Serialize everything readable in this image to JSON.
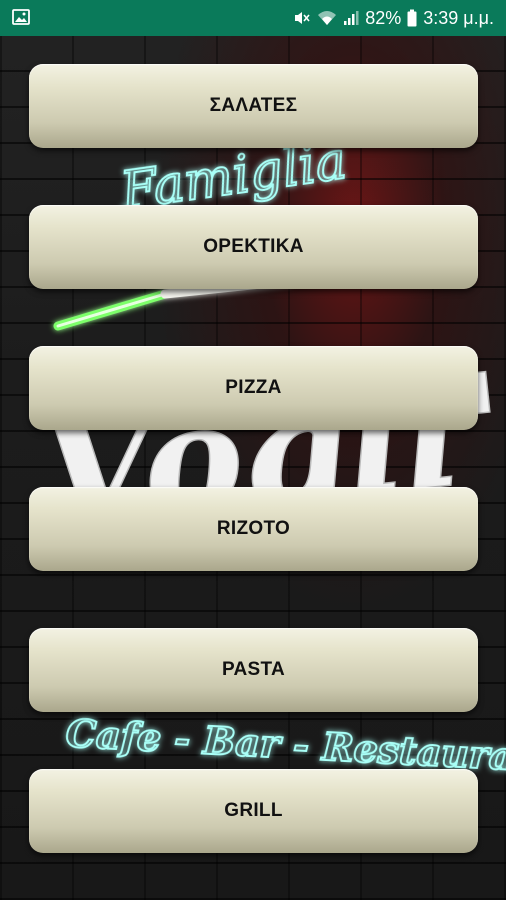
{
  "status_bar": {
    "battery_percent": "82%",
    "time": "3:39 μ.μ.",
    "icons": [
      "image-icon",
      "mute-icon",
      "wifi-icon",
      "signal-icon",
      "battery-icon"
    ],
    "background_color": "#0a7a5a"
  },
  "background": {
    "neon_text_top": "Famiglia",
    "neon_text_main": "Vogli's",
    "neon_text_bottom": "Cafe - Bar - Restaurant"
  },
  "menu": {
    "buttons": [
      {
        "label": "ΣΑΛΑΤΕΣ"
      },
      {
        "label": "ΟΡΕΚΤΙΚΑ"
      },
      {
        "label": "PIZZA"
      },
      {
        "label": "RIZOTO"
      },
      {
        "label": "PASTA"
      },
      {
        "label": "GRILL"
      }
    ]
  }
}
